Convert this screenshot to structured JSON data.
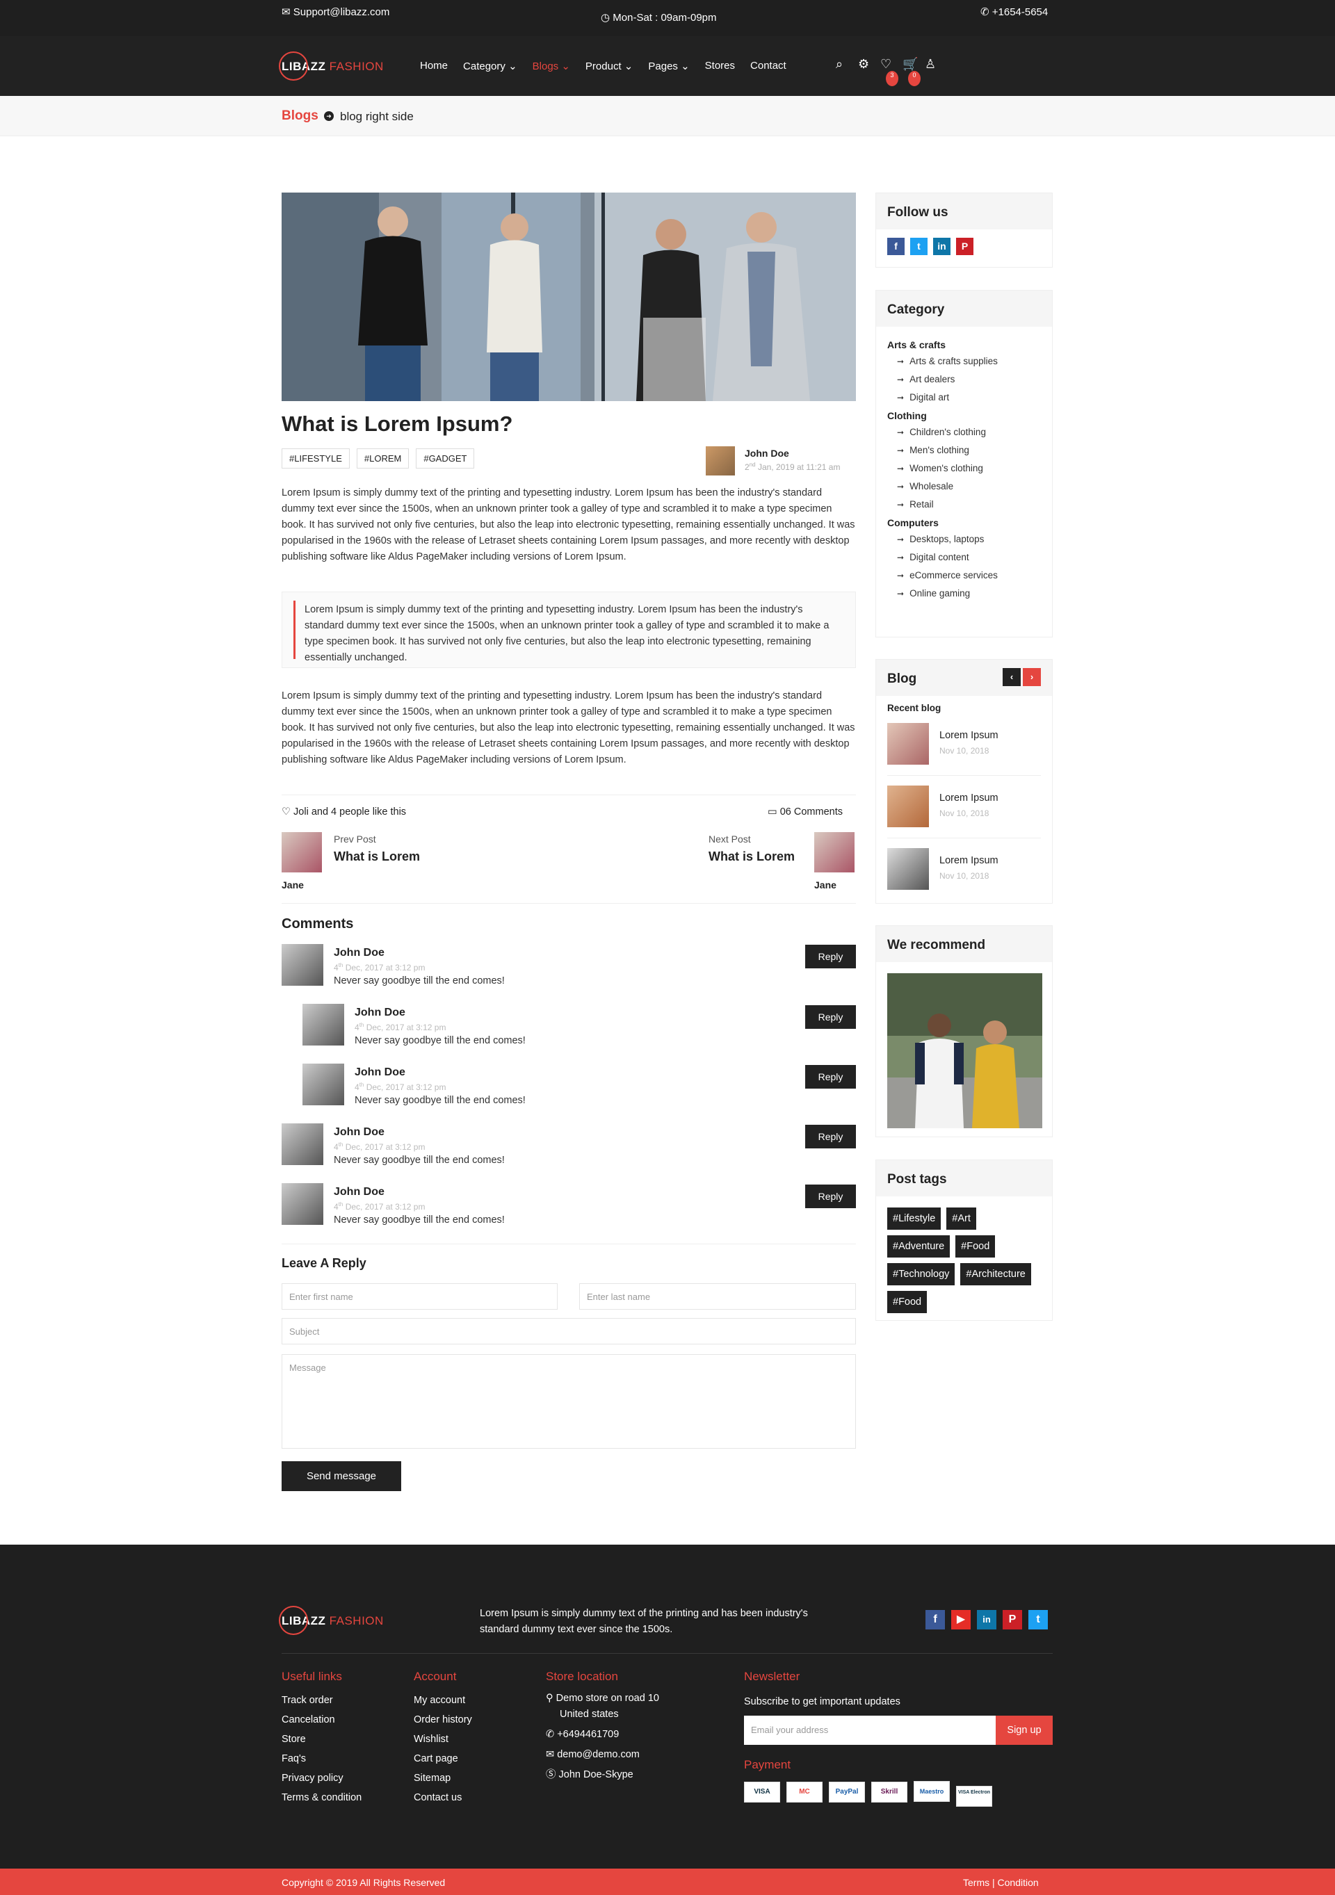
{
  "topbar": {
    "email": "Support@libazz.com",
    "hours": "Mon-Sat : 09am-09pm",
    "phone": "+1654-5654"
  },
  "brand": {
    "name": "LIBAZZ",
    "suffix": "FASHION",
    "accent": "#e5463f"
  },
  "nav": {
    "items": [
      {
        "label": "Home",
        "dropdown": false
      },
      {
        "label": "Category",
        "dropdown": true
      },
      {
        "label": "Blogs",
        "dropdown": true,
        "active": true
      },
      {
        "label": "Product",
        "dropdown": true
      },
      {
        "label": "Pages",
        "dropdown": true
      },
      {
        "label": "Stores",
        "dropdown": false
      },
      {
        "label": "Contact",
        "dropdown": false
      }
    ],
    "wishlist_count": "3",
    "cart_count": "0"
  },
  "breadcrumb": {
    "parent": "Blogs",
    "current": "blog right side"
  },
  "post": {
    "title": "What is Lorem Ipsum?",
    "tags": [
      "#LIFESTYLE",
      "#LOREM",
      "#GADGET"
    ],
    "author": "John Doe",
    "date_day": "2",
    "date_suffix": "nd",
    "date_rest": "Jan, 2019 at 11:21 am",
    "para1": "Lorem Ipsum is simply dummy text of the printing and typesetting industry. Lorem Ipsum has been the industry's standard dummy text ever since the 1500s, when an unknown printer took a galley of type and scrambled it to make a type specimen book. It has survived not only five centuries, but also the leap into electronic typesetting, remaining essentially unchanged. It was popularised in the 1960s with the release of Letraset sheets containing Lorem Ipsum passages, and more recently with desktop publishing software like Aldus PageMaker including versions of Lorem Ipsum.",
    "quote": "Lorem Ipsum is simply dummy text of the printing and typesetting industry. Lorem Ipsum has been the industry's standard dummy text ever since the 1500s, when an unknown printer took a galley of type and scrambled it to make a type specimen book. It has survived not only five centuries, but also the leap into electronic typesetting, remaining essentially unchanged.",
    "para2": "Lorem Ipsum is simply dummy text of the printing and typesetting industry. Lorem Ipsum has been the industry's standard dummy text ever since the 1500s, when an unknown printer took a galley of type and scrambled it to make a type specimen book. It has survived not only five centuries, but also the leap into electronic typesetting, remaining essentially unchanged. It was popularised in the 1960s with the release of Letraset sheets containing Lorem Ipsum passages, and more recently with desktop publishing software like Aldus PageMaker including versions of Lorem Ipsum.",
    "likes": "Joli and 4 people like this",
    "comments_count": "06 Comments"
  },
  "prev": {
    "label": "Prev Post",
    "title": "What is Lorem",
    "name": "Jane"
  },
  "next": {
    "label": "Next Post",
    "title": "What is Lorem",
    "name": "Jane"
  },
  "comments": {
    "title": "Comments",
    "reply_label": "Reply",
    "items": [
      {
        "name": "John Doe",
        "day": "4",
        "suffix": "th",
        "rest": "Dec, 2017 at 3:12 pm",
        "text": "Never say goodbye till the end comes!",
        "nested": false
      },
      {
        "name": "John Doe",
        "day": "4",
        "suffix": "th",
        "rest": "Dec, 2017 at 3:12 pm",
        "text": "Never say goodbye till the end comes!",
        "nested": true
      },
      {
        "name": "John Doe",
        "day": "4",
        "suffix": "th",
        "rest": "Dec, 2017 at 3:12 pm",
        "text": "Never say goodbye till the end comes!",
        "nested": true
      },
      {
        "name": "John Doe",
        "day": "4",
        "suffix": "th",
        "rest": "Dec, 2017 at 3:12 pm",
        "text": "Never say goodbye till the end comes!",
        "nested": false
      },
      {
        "name": "John Doe",
        "day": "4",
        "suffix": "th",
        "rest": "Dec, 2017 at 3:12 pm",
        "text": "Never say goodbye till the end comes!",
        "nested": false
      }
    ]
  },
  "form": {
    "title": "Leave A Reply",
    "first_placeholder": "Enter first name",
    "last_placeholder": "Enter last name",
    "subject_placeholder": "Subject",
    "message_placeholder": "Message",
    "submit": "Send message"
  },
  "sidebar": {
    "follow_title": "Follow us",
    "category_title": "Category",
    "categories": [
      {
        "group": "Arts & crafts",
        "items": [
          "Arts & crafts supplies",
          "Art dealers",
          "Digital art"
        ]
      },
      {
        "group": "Clothing",
        "items": [
          "Children's clothing",
          "Men's clothing",
          "Women's clothing",
          "Wholesale",
          "Retail"
        ]
      },
      {
        "group": "Computers",
        "items": [
          "Desktops, laptops",
          "Digital content",
          "eCommerce services",
          "Online gaming"
        ]
      }
    ],
    "blog_title": "Blog",
    "recent_label": "Recent blog",
    "recent": [
      {
        "title": "Lorem Ipsum",
        "date": "Nov 10, 2018"
      },
      {
        "title": "Lorem Ipsum",
        "date": "Nov 10, 2018"
      },
      {
        "title": "Lorem Ipsum",
        "date": "Nov 10, 2018"
      }
    ],
    "recommend_title": "We recommend",
    "tags_title": "Post tags",
    "tags": [
      "#Lifestyle",
      "#Art",
      "#Adventure",
      "#Food",
      "#Technology",
      "#Architecture",
      "#Food"
    ]
  },
  "footer": {
    "about": "Lorem Ipsum is simply dummy text of the printing and has been industry's standard dummy text ever since the 1500s.",
    "useful_title": "Useful links",
    "useful": [
      "Track order",
      "Cancelation",
      "Store",
      "Faq's",
      "Privacy policy",
      "Terms & condition"
    ],
    "account_title": "Account",
    "account": [
      "My account",
      "Order history",
      "Wishlist",
      "Cart page",
      "Sitemap",
      "Contact us"
    ],
    "store_title": "Store location",
    "address1": "Demo store on road 10",
    "address2": "United states",
    "phone": "+6494461709",
    "email": "demo@demo.com",
    "skype": "John Doe-Skype",
    "newsletter_title": "Newsletter",
    "newsletter_text": "Subscribe to get important updates",
    "email_placeholder": "Email your address",
    "signup": "Sign up",
    "payment_title": "Payment",
    "payments": [
      "VISA",
      "MC",
      "PayPal",
      "Skrill",
      "Maestro",
      "VISA Electron"
    ],
    "copyright": "Copyright © 2019 All Rights Reserved",
    "terms": "Terms | Condition"
  }
}
